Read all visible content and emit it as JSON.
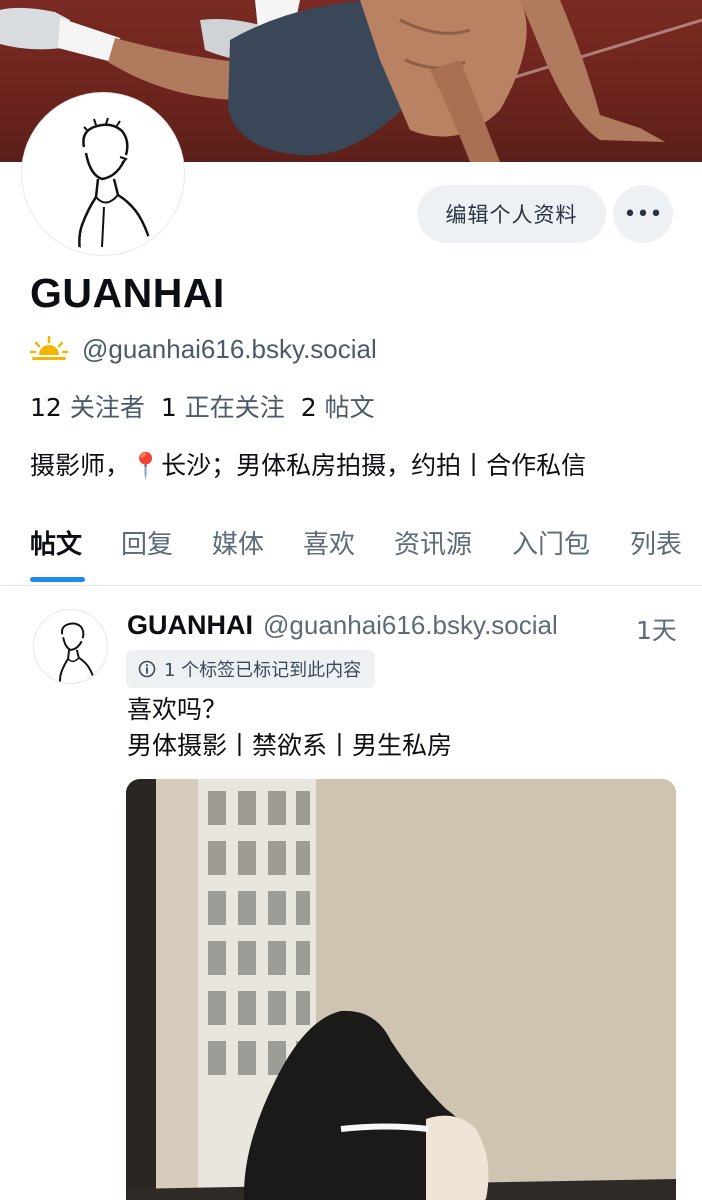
{
  "profile": {
    "display_name": "GUANHAI",
    "handle": "@guanhai616.bsky.social",
    "handle_icon": "sunrise-icon",
    "bio": "摄影师，📍长沙；男体私房拍摄，约拍丨合作私信",
    "stats": {
      "followers_count": "12",
      "followers_label": "关注者",
      "following_count": "1",
      "following_label": "正在关注",
      "posts_count": "2",
      "posts_label": "帖文"
    }
  },
  "actions": {
    "edit_label": "编辑个人资料",
    "more_label": "•••"
  },
  "tabs": [
    {
      "label": "帖文",
      "active": true
    },
    {
      "label": "回复"
    },
    {
      "label": "媒体"
    },
    {
      "label": "喜欢"
    },
    {
      "label": "资讯源"
    },
    {
      "label": "入门包"
    },
    {
      "label": "列表"
    }
  ],
  "post": {
    "author_name": "GUANHAI",
    "author_handle": "@guanhai616.bsky.social",
    "time": "1天",
    "label_notice": "1 个标签已标记到此内容",
    "text_line1": "喜欢吗？",
    "text_line2": "男体摄影丨禁欲系丨男生私房"
  },
  "colors": {
    "accent": "#1f8bf0",
    "banner": "#6b241d",
    "muted_text": "#5b6b7b",
    "pill_bg": "#eef1f4"
  }
}
